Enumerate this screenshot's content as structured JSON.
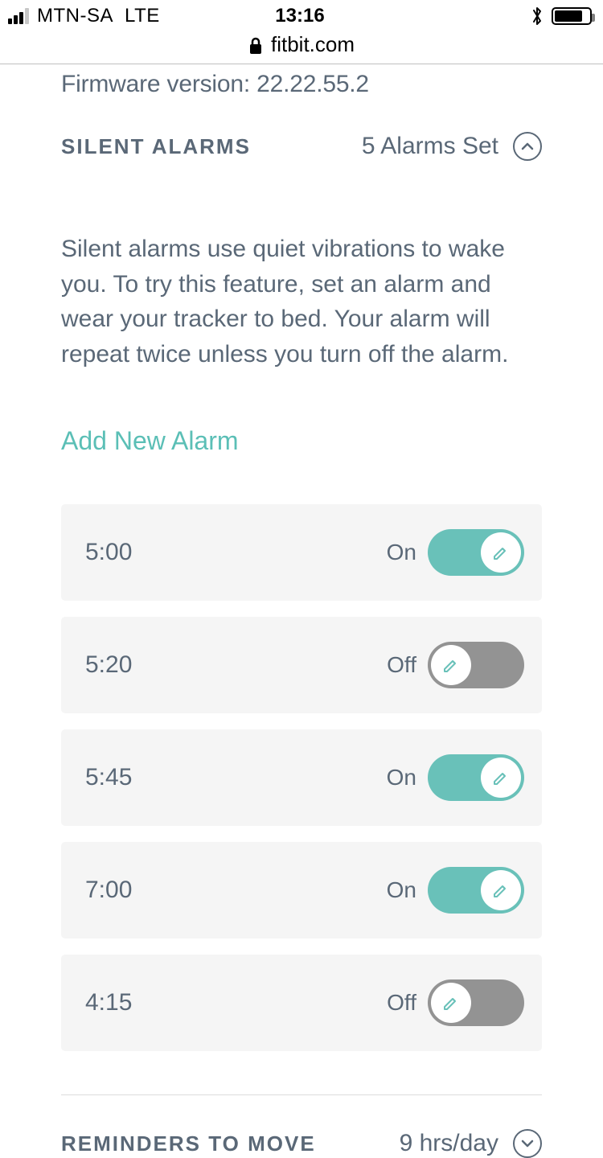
{
  "status_bar": {
    "carrier": "MTN-SA",
    "network": "LTE",
    "time": "13:16"
  },
  "url_bar": {
    "domain": "fitbit.com"
  },
  "firmware": {
    "label": "Firmware version:",
    "value": "22.22.55.2"
  },
  "silent_alarms": {
    "title": "SILENT ALARMS",
    "count_text": "5 Alarms Set",
    "description": "Silent alarms use quiet vibrations to wake you. To try this feature, set an alarm and wear your tracker to bed. Your alarm will repeat twice unless you turn off the alarm.",
    "add_label": "Add New Alarm",
    "alarms": [
      {
        "time": "5:00",
        "state": "On",
        "on": true
      },
      {
        "time": "5:20",
        "state": "Off",
        "on": false
      },
      {
        "time": "5:45",
        "state": "On",
        "on": true
      },
      {
        "time": "7:00",
        "state": "On",
        "on": true
      },
      {
        "time": "4:15",
        "state": "Off",
        "on": false
      }
    ]
  },
  "reminders": {
    "title": "REMINDERS TO MOVE",
    "value": "9 hrs/day"
  },
  "colors": {
    "accent": "#5bbfb6",
    "text": "#5a6877",
    "toggle_off": "#939393",
    "row_bg": "#f5f5f5"
  }
}
